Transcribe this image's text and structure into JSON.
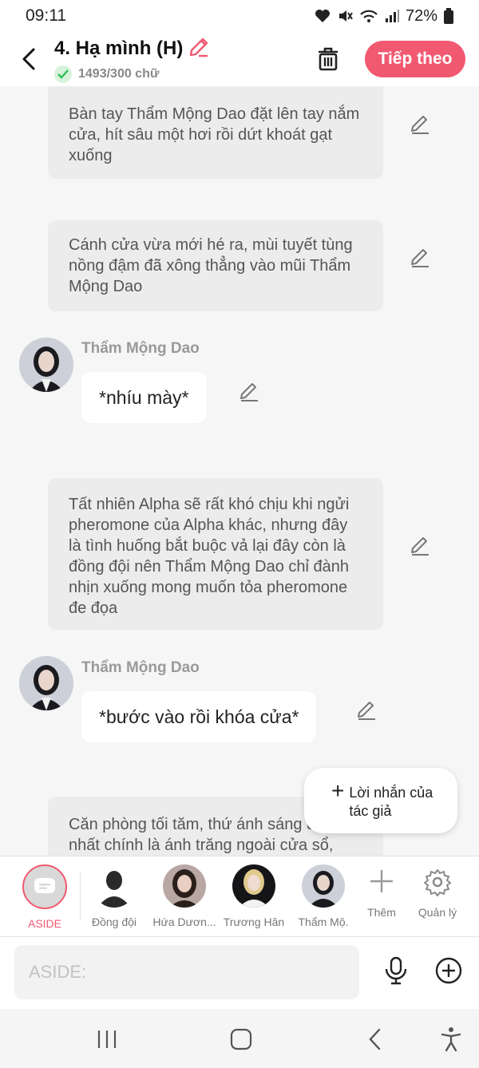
{
  "status_bar": {
    "time": "09:11",
    "battery": "72%"
  },
  "header": {
    "title": "4. Hạ mình (H)",
    "counter": "1493/300 chữ",
    "next_label": "Tiếp theo"
  },
  "messages": {
    "m1": "Bàn tay Thẩm Mộng Dao đặt lên tay nắm cửa, hít sâu một hơi rồi dứt khoát gạt xuống",
    "m2": "Cánh cửa vừa mới hé ra, mùi tuyết tùng nồng đậm đã xông thẳng vào mũi Thẩm Mộng Dao",
    "m3_name": "Thẩm Mộng Dao",
    "m3_text": "*nhíu mày*",
    "m4": "Tất nhiên Alpha sẽ rất khó chịu khi ngửi pheromone của Alpha khác, nhưng đây là tình huống bắt buộc vả lại đây còn là đồng đội nên Thẩm Mộng Dao chỉ đành nhịn xuống mong muốn tỏa pheromone đe đọa",
    "m5_name": "Thẩm Mộng Dao",
    "m5_text": "*bước vào rồi khóa cửa*",
    "m6": "Căn phòng tối tăm, thứ ánh sáng duy nhất chính là ánh trăng ngoài cửa sổ,"
  },
  "author_note": {
    "label": "Lời nhắn của tác giả"
  },
  "char_bar": {
    "aside": "ASIDE",
    "teammate": "Đồng đội",
    "hua_duong": "Hứa Dươn...",
    "truong_han": "Trương Hân",
    "tham_mong": "Thẩm Mộ.",
    "add": "Thêm",
    "manage": "Quản lý"
  },
  "input": {
    "placeholder": "ASIDE:"
  },
  "colors": {
    "accent": "#f05970",
    "bubble": "#ececec",
    "background": "#f6f6f6"
  },
  "icons": [
    "back-arrow-icon",
    "pencil-icon",
    "check-icon",
    "trash-icon",
    "edit-pencil-icon",
    "plus-icon",
    "gear-icon",
    "microphone-icon",
    "add-circle-icon",
    "recents-icon",
    "home-icon",
    "back-nav-icon",
    "accessibility-icon"
  ]
}
